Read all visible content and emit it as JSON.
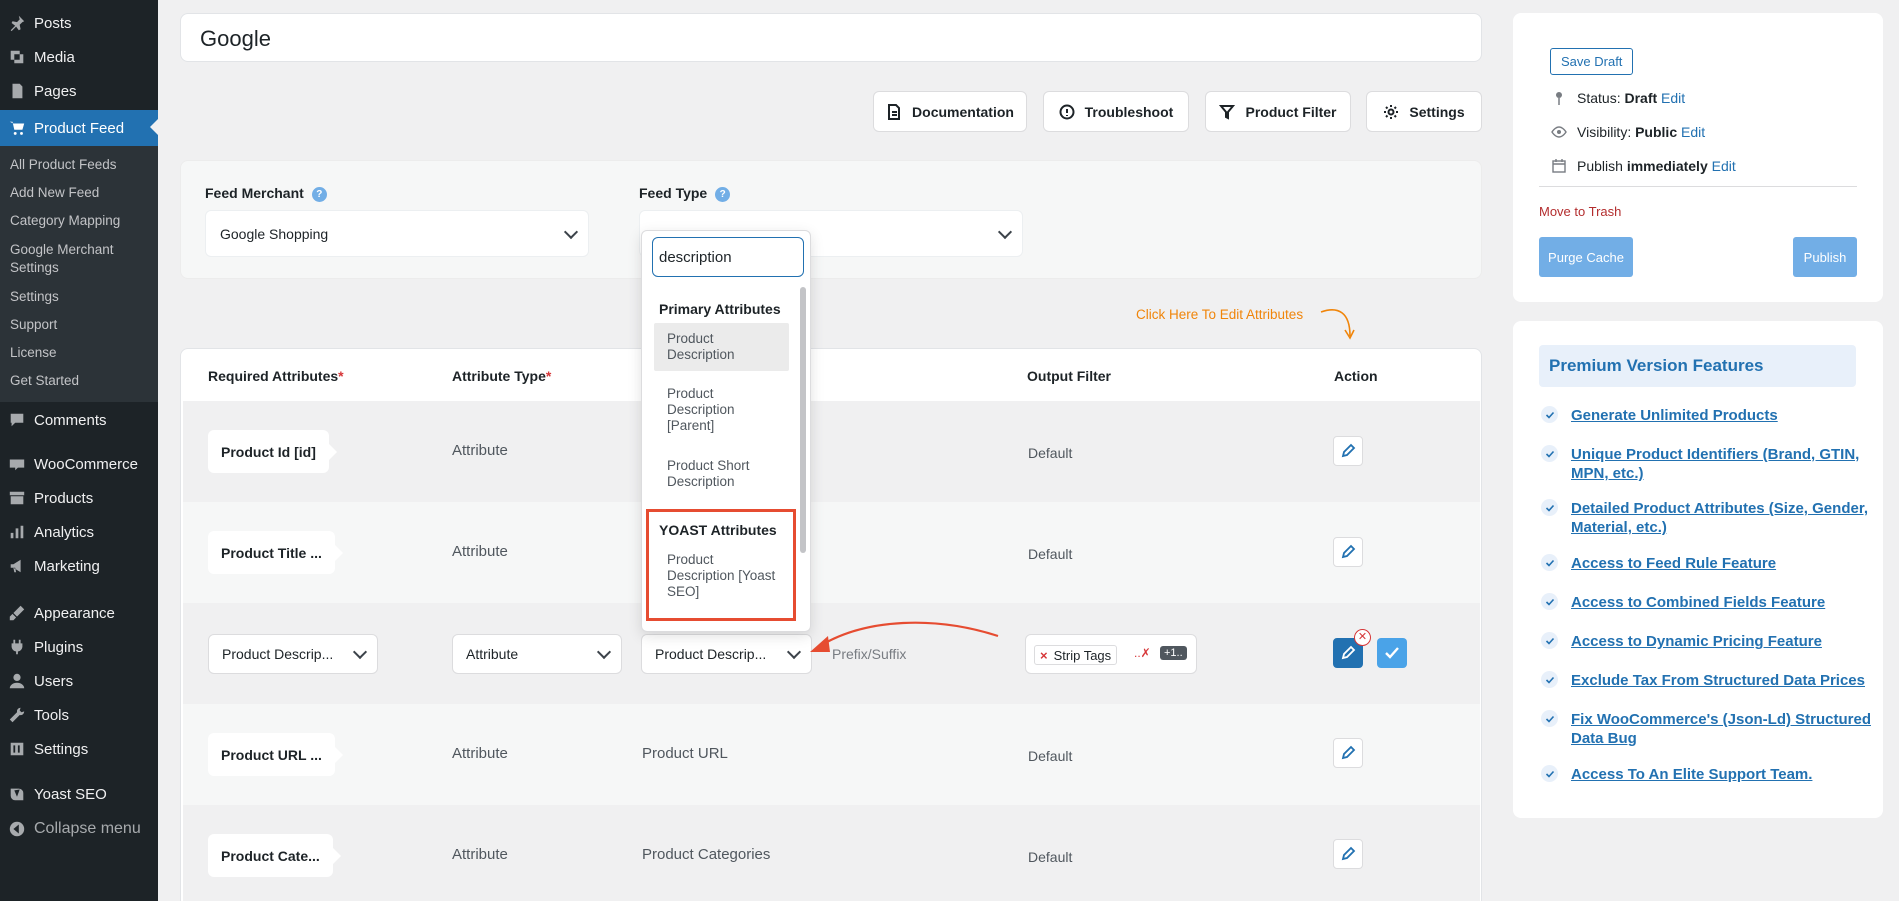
{
  "sidebar": {
    "items": [
      {
        "label": "Posts",
        "icon": "pin-icon"
      },
      {
        "label": "Media",
        "icon": "media-icon"
      },
      {
        "label": "Pages",
        "icon": "pages-icon"
      },
      {
        "label": "Product Feed",
        "icon": "cart-icon"
      },
      {
        "label": "Comments",
        "icon": "comments-icon"
      },
      {
        "label": "WooCommerce",
        "icon": "woo-icon"
      },
      {
        "label": "Products",
        "icon": "archive-icon"
      },
      {
        "label": "Analytics",
        "icon": "chart-icon"
      },
      {
        "label": "Marketing",
        "icon": "megaphone-icon"
      },
      {
        "label": "Appearance",
        "icon": "brush-icon"
      },
      {
        "label": "Plugins",
        "icon": "plug-icon"
      },
      {
        "label": "Users",
        "icon": "user-icon"
      },
      {
        "label": "Tools",
        "icon": "wrench-icon"
      },
      {
        "label": "Settings",
        "icon": "settings-icon"
      },
      {
        "label": "Yoast SEO",
        "icon": "yoast-icon"
      },
      {
        "label": "Collapse menu",
        "icon": "collapse-icon"
      }
    ],
    "submenu": [
      "All Product Feeds",
      "Add New Feed",
      "Category Mapping",
      "Google Merchant Settings",
      "Settings",
      "Support",
      "License",
      "Get Started"
    ]
  },
  "feed_title": "Google",
  "toolbar": {
    "documentation": "Documentation",
    "troubleshoot": "Troubleshoot",
    "product_filter": "Product Filter",
    "settings": "Settings"
  },
  "merchant": {
    "feed_merchant_label": "Feed Merchant",
    "feed_merchant_value": "Google Shopping",
    "feed_type_label": "Feed Type",
    "help": "?"
  },
  "hint": "Click Here To Edit Attributes",
  "table": {
    "headers": {
      "required": "Required Attributes",
      "type": "Attribute Type",
      "output": "Output Filter",
      "action": "Action",
      "required_mark": "*"
    },
    "rows": [
      {
        "attr": "Product Id [id]",
        "type": "Attribute",
        "value": "",
        "output": "Default"
      },
      {
        "attr": "Product Title ...",
        "type": "Attribute",
        "value": "",
        "output": "Default"
      },
      {
        "attr": "Product Descrip...",
        "type": "Attribute",
        "value": "Product Descrip...",
        "prefix": "Prefix/Suffix",
        "filter_tag": "Strip Tags",
        "filter_more": "+1..",
        "filter_remove": "×"
      },
      {
        "attr": "Product URL ...",
        "type": "Attribute",
        "value": "Product URL",
        "output": "Default"
      },
      {
        "attr": "Product Cate...",
        "type": "Attribute",
        "value": "Product Categories",
        "output": "Default"
      }
    ]
  },
  "dropdown": {
    "search_value": "description",
    "groups": [
      {
        "name": "Primary Attributes",
        "options": [
          "Product Description",
          "Product Description [Parent]",
          "Product Short Description"
        ]
      },
      {
        "name": "YOAST Attributes",
        "options": [
          "Product Description [Yoast SEO]"
        ]
      }
    ]
  },
  "publish": {
    "save_draft": "Save Draft",
    "status_label": "Status:",
    "status_value": "Draft",
    "visibility_label": "Visibility:",
    "visibility_value": "Public",
    "publish_label": "Publish",
    "publish_value": "immediately",
    "edit": "Edit",
    "move_to_trash": "Move to Trash",
    "purge_cache": "Purge Cache",
    "publish_button": "Publish"
  },
  "premium": {
    "title": "Premium Version Features",
    "features": [
      "Generate Unlimited Products",
      "Unique Product Identifiers (Brand, GTIN, MPN, etc.)",
      "Detailed Product Attributes (Size, Gender, Material, etc.)",
      "Access to Feed Rule Feature",
      "Access to Combined Fields Feature",
      "Access to Dynamic Pricing Feature",
      "Exclude Tax From Structured Data Prices",
      "Fix WooCommerce's (Json-Ld) Structured Data Bug",
      "Access To An Elite Support Team."
    ]
  },
  "colors": {
    "accent": "#2271b1",
    "sidebar": "#1d2327",
    "highlight_box": "#e64c31",
    "hint": "#f0850a"
  }
}
